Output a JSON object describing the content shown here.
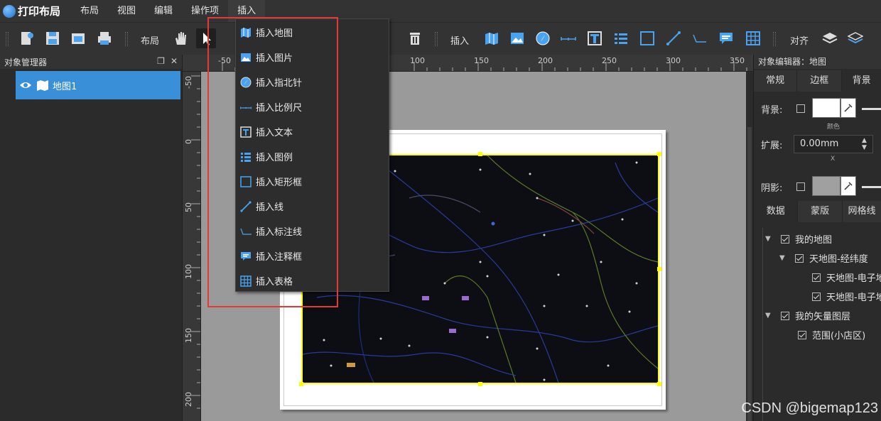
{
  "app": {
    "title": "打印布局"
  },
  "menu": {
    "items": [
      "布局",
      "视图",
      "编辑",
      "操作项",
      "插入"
    ]
  },
  "toolbar": {
    "layout_label": "布局",
    "insert_label": "插入",
    "align_label": "对齐"
  },
  "left_panel": {
    "title": "对象管理器",
    "items": [
      {
        "label": "地图1"
      }
    ]
  },
  "ruler": {
    "top_ticks": [
      "-50",
      "100",
      "150",
      "200",
      "250",
      "300",
      "350"
    ],
    "left_ticks": [
      "-50",
      "0",
      "50",
      "100",
      "150",
      "200"
    ]
  },
  "dropdown": {
    "items": [
      {
        "label": "插入地图",
        "icon": "map-icon"
      },
      {
        "label": "插入图片",
        "icon": "image-icon"
      },
      {
        "label": "插入指北针",
        "icon": "compass-icon"
      },
      {
        "label": "插入比例尺",
        "icon": "scale-bar-icon"
      },
      {
        "label": "插入文本",
        "icon": "text-icon"
      },
      {
        "label": "插入图例",
        "icon": "legend-icon"
      },
      {
        "label": "插入矩形框",
        "icon": "rectangle-icon"
      },
      {
        "label": "插入线",
        "icon": "line-icon"
      },
      {
        "label": "插入标注线",
        "icon": "callout-line-icon"
      },
      {
        "label": "插入注释框",
        "icon": "comment-icon"
      },
      {
        "label": "插入表格",
        "icon": "table-icon"
      }
    ]
  },
  "right_panel": {
    "title": "对象编辑器：地图",
    "tabs1": [
      "常规",
      "边框",
      "背景"
    ],
    "background_label": "背景:",
    "color_caption": "颜色",
    "expand_label": "扩展:",
    "expand_value": "0.00mm",
    "expand_axis": "X",
    "shadow_label": "阴影:",
    "tabs2": [
      "数据",
      "蒙版",
      "网格线"
    ],
    "layers": [
      {
        "label": "我的地图",
        "level": 0,
        "expandable": true
      },
      {
        "label": "天地图-经纬度",
        "level": 1,
        "expandable": true
      },
      {
        "label": "天地图-电子地图",
        "level": 2,
        "expandable": false
      },
      {
        "label": "天地图-电子地图注记",
        "level": 2,
        "expandable": false
      },
      {
        "label": "我的矢量图层",
        "level": 0,
        "expandable": true
      },
      {
        "label": "范围(小店区)",
        "level": 1,
        "expandable": false
      }
    ]
  },
  "colors": {
    "accent": "#3a8fd9",
    "highlight_box": "#e53935",
    "selection": "#ffff00"
  },
  "watermark": "CSDN @bigemap123"
}
